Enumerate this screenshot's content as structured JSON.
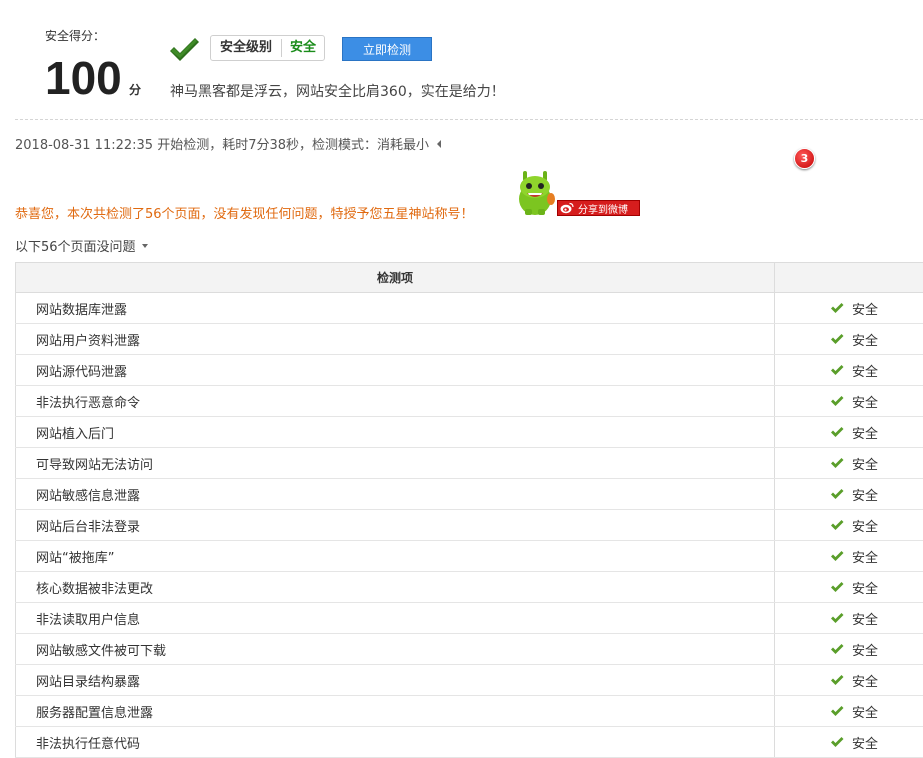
{
  "score": {
    "label": "安全得分：",
    "value": "100",
    "unit": "分"
  },
  "level": {
    "label": "安全级别",
    "value": "安全"
  },
  "detect_button": "立即检测",
  "tagline": "神马黑客都是浮云，网站安全比肩360，实在是给力！",
  "scan_info": "2018-08-31 11:22:35 开始检测，耗时7分38秒，检测模式：消耗最小",
  "notification_count": "3",
  "congrats": "恭喜您，本次共检测了56个页面，没有发现任何问题，特授予您五星神站称号！",
  "share_button": "分享到微博",
  "list_header": "以下56个页面没问题",
  "table": {
    "header": "检测项",
    "rows": [
      {
        "item": "网站数据库泄露",
        "status": "安全"
      },
      {
        "item": "网站用户资料泄露",
        "status": "安全"
      },
      {
        "item": "网站源代码泄露",
        "status": "安全"
      },
      {
        "item": "非法执行恶意命令",
        "status": "安全"
      },
      {
        "item": "网站植入后门",
        "status": "安全"
      },
      {
        "item": "可导致网站无法访问",
        "status": "安全"
      },
      {
        "item": "网站敏感信息泄露",
        "status": "安全"
      },
      {
        "item": "网站后台非法登录",
        "status": "安全"
      },
      {
        "item": "网站“被拖库”",
        "status": "安全"
      },
      {
        "item": "核心数据被非法更改",
        "status": "安全"
      },
      {
        "item": "非法读取用户信息",
        "status": "安全"
      },
      {
        "item": "网站敏感文件被可下载",
        "status": "安全"
      },
      {
        "item": "网站目录结构暴露",
        "status": "安全"
      },
      {
        "item": "服务器配置信息泄露",
        "status": "安全"
      },
      {
        "item": "非法执行任意代码",
        "status": "安全"
      }
    ]
  },
  "colors": {
    "safe_green": "#1a8c1a",
    "check_green": "#5a9e2a",
    "button_blue": "#3c8ee5",
    "congrats_orange": "#e06a10",
    "share_red": "#d61d1d"
  }
}
